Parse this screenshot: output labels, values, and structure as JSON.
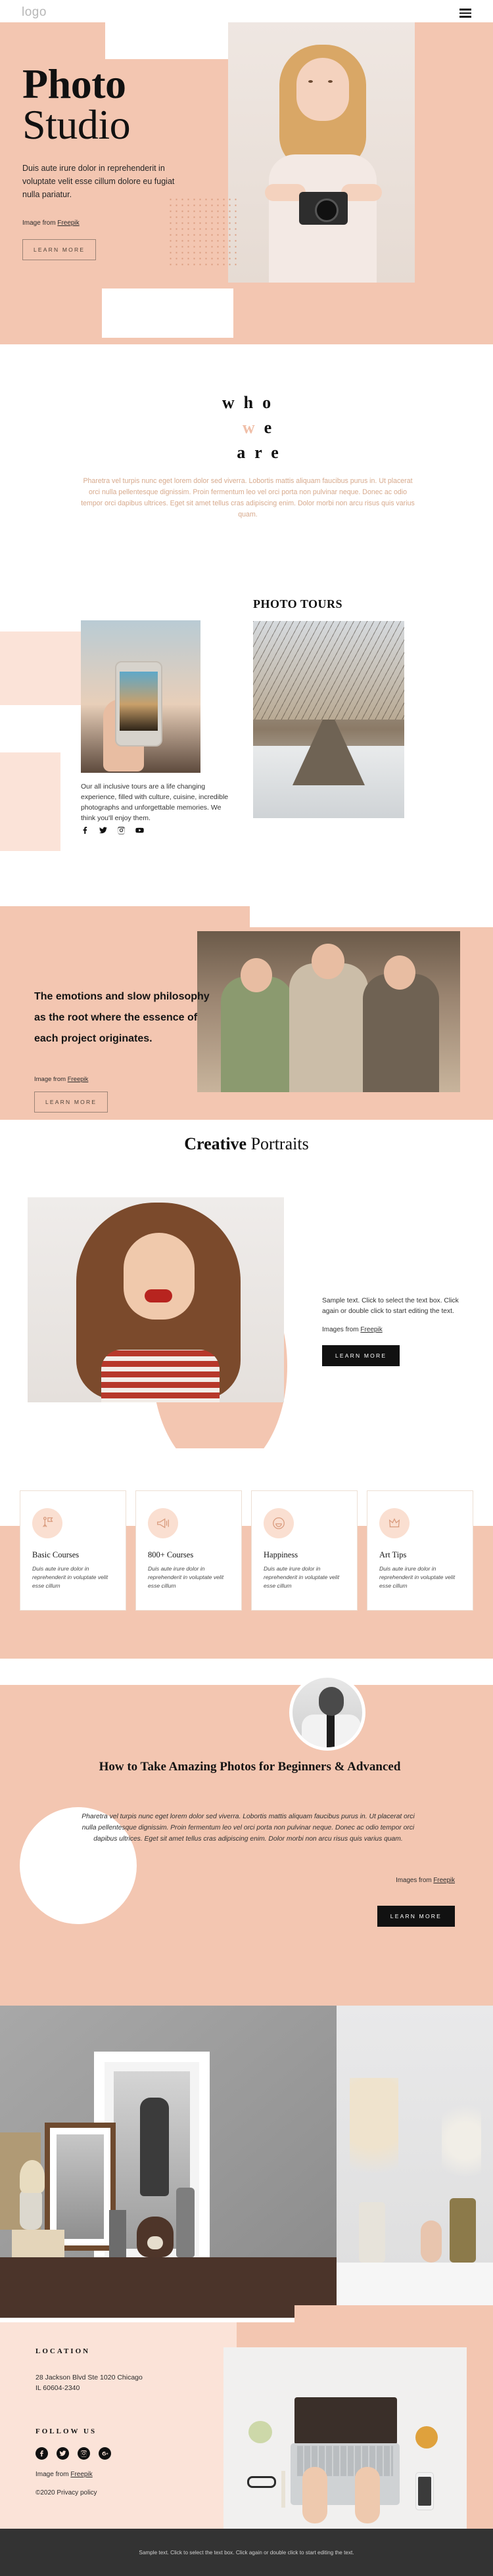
{
  "header": {
    "logo": "logo",
    "menu_icon": "hamburger-menu-icon"
  },
  "hero": {
    "title_line1": "Photo",
    "title_line2": "Studio",
    "paragraph": "Duis aute irure dolor in reprehenderit in voluptate velit esse cillum dolore eu fugiat nulla pariatur.",
    "credit_prefix": "Image from ",
    "credit_link": "Freepik",
    "cta": "LEARN MORE"
  },
  "who": {
    "word1": "w",
    "word2": "h",
    "word3": "o",
    "word4": "w",
    "word5": "e",
    "word6": "a",
    "word7": "r",
    "word8": "e",
    "paragraph": "Pharetra vel turpis nunc eget lorem dolor sed viverra. Lobortis mattis aliquam faucibus purus in. Ut placerat orci nulla pellentesque dignissim. Proin fermentum leo vel orci porta non pulvinar neque. Donec ac odio tempor orci dapibus ultrices. Eget sit amet tellus cras adipiscing enim. Dolor morbi non arcu risus quis varius quam."
  },
  "tours": {
    "heading": "PHOTO TOURS",
    "paragraph": "Our all inclusive tours are a life changing experience, filled with culture, cuisine, incredible photographs and unforgettable memories. We think you'll enjoy them.",
    "socials": [
      "facebook-icon",
      "twitter-icon",
      "instagram-icon",
      "youtube-icon"
    ]
  },
  "emotions": {
    "heading": "The emotions and slow philosophy as the root where the essence of each project originates.",
    "credit_prefix": "Image from ",
    "credit_link": "Freepik",
    "cta": "LEARN MORE"
  },
  "portraits": {
    "title_bold": "Creative",
    "title_light": " Portraits",
    "paragraph": "Sample text. Click to select the text box. Click again or double click to start editing the text.",
    "credit_prefix": "Images from ",
    "credit_link": "Freepik",
    "cta": "LEARN MORE"
  },
  "features": {
    "cards": [
      {
        "icon": "explorer-flag-icon",
        "title": "Basic Courses",
        "text": "Duis aute irure dolor in reprehenderit in voluptate velit esse cillum"
      },
      {
        "icon": "megaphone-icon",
        "title": "800+ Courses",
        "text": "Duis aute irure dolor in reprehenderit in voluptate velit esse cillum"
      },
      {
        "icon": "smiley-face-icon",
        "title": "Happiness",
        "text": "Duis aute irure dolor in reprehenderit in voluptate velit esse cillum"
      },
      {
        "icon": "crown-icon",
        "title": "Art Tips",
        "text": "Duis aute irure dolor in reprehenderit in voluptate velit esse cillum"
      }
    ]
  },
  "howto": {
    "heading": "How to Take Amazing Photos for Beginners & Advanced",
    "paragraph": "Pharetra vel turpis nunc eget lorem dolor sed viverra. Lobortis mattis aliquam faucibus purus in. Ut placerat orci nulla pellentesque dignissim. Proin fermentum leo vel orci porta non pulvinar neque. Donec ac odio tempor orci dapibus ultrices. Eget sit amet tellus cras adipiscing enim. Dolor morbi non arcu risus quis varius quam.",
    "credit_prefix": "Images from ",
    "credit_link": "Freepik",
    "cta": "LEARN MORE"
  },
  "footer": {
    "location_title": "LOCATION",
    "address_line1": "28 Jackson Blvd Ste 1020 Chicago",
    "address_line2": "IL 60604-2340",
    "follow_title": "FOLLOW US",
    "socials": [
      {
        "name": "facebook-icon",
        "glyph": "f"
      },
      {
        "name": "twitter-icon",
        "glyph": "✓"
      },
      {
        "name": "instagram-icon",
        "glyph": "□"
      },
      {
        "name": "google-plus-icon",
        "glyph": "G"
      }
    ],
    "credit_prefix": "Image from ",
    "credit_link": "Freepik",
    "copyright": "©2020 Privacy policy"
  },
  "bottom_bar": {
    "text": "Sample text. Click to select the text box. Click again or double click to start editing the text."
  },
  "colors": {
    "peach": "#f3c6b1",
    "peach_light": "#fbe3d8",
    "dark": "#111111",
    "bottom_bar": "#333333",
    "muted_text": "#d7a98c"
  }
}
